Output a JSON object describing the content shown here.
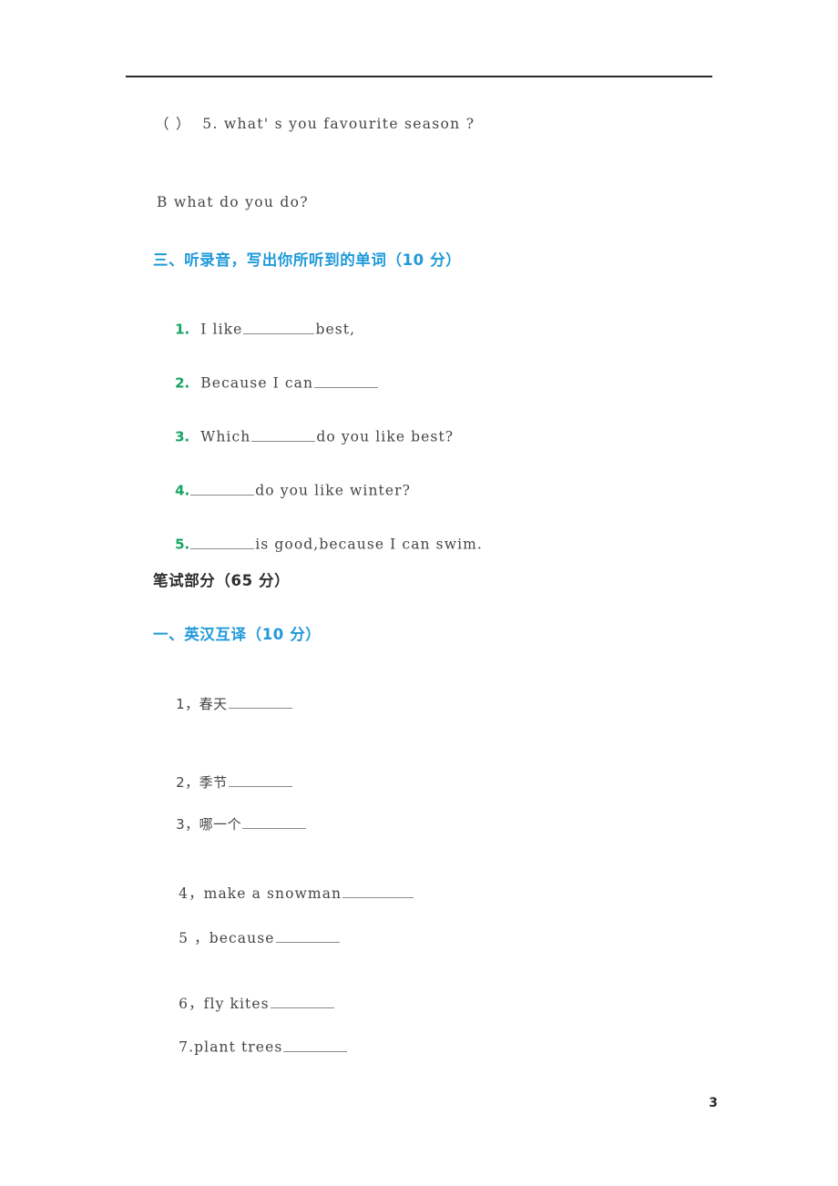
{
  "page": {
    "number": "3",
    "divider": "horizontal-rule"
  },
  "listening_carryover": {
    "question_5": "（ ）  5. what' s you favourite season ?",
    "option_b": "B what do you do?"
  },
  "section_three": {
    "heading": "三、听录音，写出你所听到的单词（10 分）",
    "items": [
      {
        "num": "1.",
        "pre": "  I like",
        "blank": "",
        "post": "best,"
      },
      {
        "num": "2.",
        "pre": "  Because I can",
        "blank": "",
        "post": ""
      },
      {
        "num": "3.",
        "pre": "  Which",
        "blank": "",
        "post": "do you like best?"
      },
      {
        "num": "4.",
        "pre": "",
        "blank": "",
        "post": "do you like winter?"
      },
      {
        "num": "5.",
        "pre": "",
        "blank": "",
        "post": "is good,because I can swim."
      }
    ]
  },
  "written_part": {
    "heading": "笔试部分（65 分）"
  },
  "section_one": {
    "heading": "一、英汉互译（10 分）",
    "items": [
      {
        "num": "1，",
        "text": "春天",
        "post": ""
      },
      {
        "num": "2，",
        "text": "季节",
        "post": ""
      },
      {
        "num": "3，",
        "text": "哪一个",
        "post": ""
      },
      {
        "num": "4，",
        "text": "make a snowman",
        "post": ""
      },
      {
        "num": "5 ，",
        "text": "because",
        "post": ""
      },
      {
        "num": "6，",
        "text": "fly kites",
        "post": ""
      },
      {
        "num": "7.",
        "text": "plant trees",
        "post": ""
      }
    ]
  },
  "colors": {
    "heading_blue": "#1f9ada",
    "number_green": "#16a463",
    "body_text": "#454545",
    "rule": "#2b2b2b"
  }
}
